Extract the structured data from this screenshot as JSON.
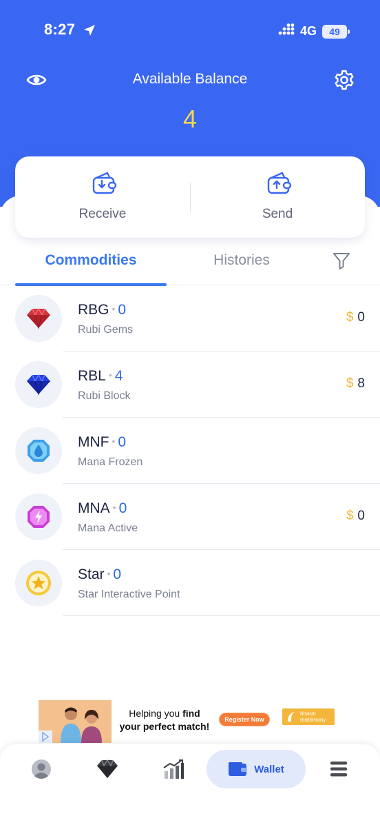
{
  "status_bar": {
    "time": "8:27",
    "network": "4G",
    "battery": "49"
  },
  "header": {
    "title": "Available Balance",
    "balance": "4",
    "eye_icon": "eye-icon",
    "settings_icon": "gear-icon"
  },
  "actions": {
    "receive_label": "Receive",
    "send_label": "Send"
  },
  "tabs": {
    "commodities": "Commodities",
    "histories": "Histories",
    "active": "Commodities"
  },
  "commodities": [
    {
      "symbol": "RBG",
      "qty": "0",
      "name": "Rubi Gems",
      "currency": "$",
      "value": "0",
      "icon": "red-gem-icon"
    },
    {
      "symbol": "RBL",
      "qty": "4",
      "name": "Rubi Block",
      "currency": "$",
      "value": "8",
      "icon": "blue-gem-icon"
    },
    {
      "symbol": "MNF",
      "qty": "0",
      "name": "Mana Frozen",
      "currency": "",
      "value": "",
      "icon": "mana-frozen-icon"
    },
    {
      "symbol": "MNA",
      "qty": "0",
      "name": "Mana Active",
      "currency": "$",
      "value": "0",
      "icon": "mana-active-icon"
    },
    {
      "symbol": "Star",
      "qty": "0",
      "name": "Star Interactive Point",
      "currency": "",
      "value": "",
      "icon": "star-icon"
    }
  ],
  "ad": {
    "line1_a": "Helping you ",
    "line1_b": "find",
    "line2": "your perfect match!",
    "cta": "Register Now",
    "brand_line1": "bharat",
    "brand_line2": "matrimony"
  },
  "bottom_nav": {
    "wallet_label": "Wallet",
    "active": "Wallet"
  },
  "colors": {
    "primary": "#3a67f1",
    "accent_yellow": "#f5d84a",
    "currency": "#f1b83a",
    "tab_active": "#3a78f2"
  }
}
